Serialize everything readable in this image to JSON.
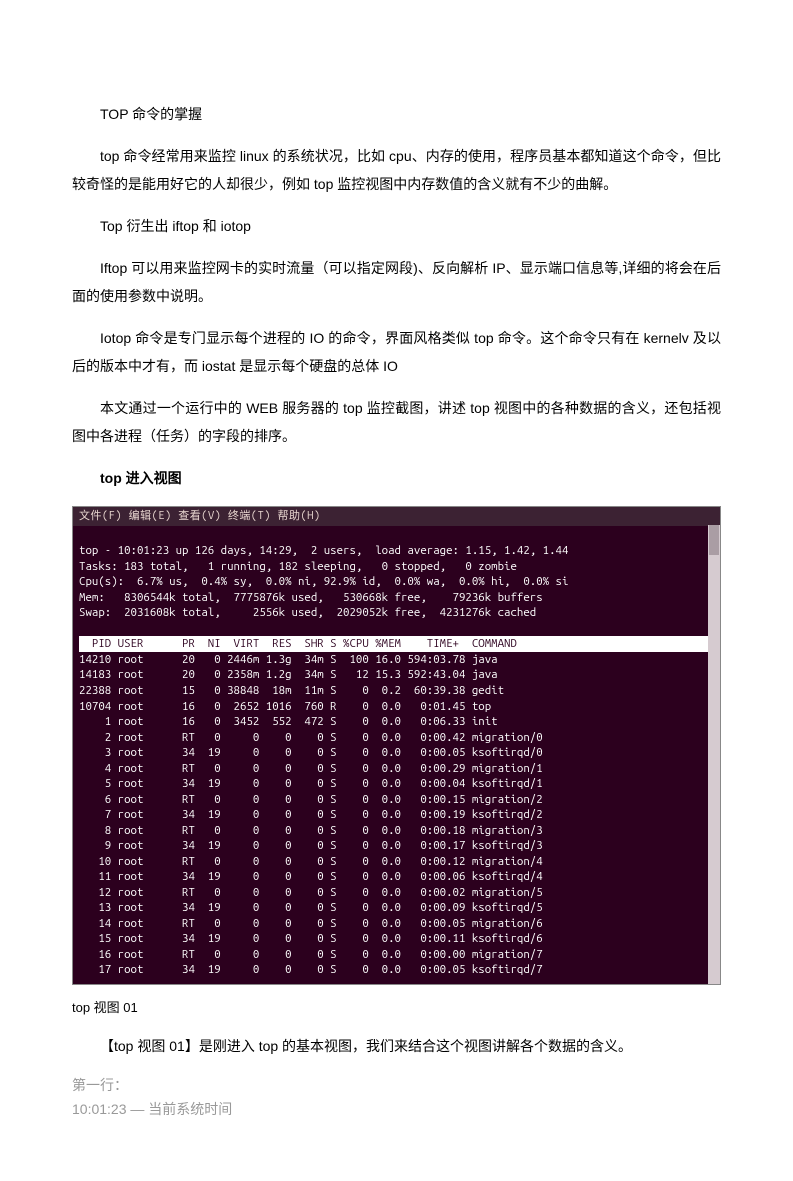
{
  "title": "TOP 命令的掌握",
  "para1": "top 命令经常用来监控 linux 的系统状况，比如 cpu、内存的使用，程序员基本都知道这个命令，但比较奇怪的是能用好它的人却很少，例如 top 监控视图中内存数值的含义就有不少的曲解。",
  "para2": "Top 衍生出 iftop  和  iotop",
  "para3": "Iftop 可以用来监控网卡的实时流量（可以指定网段)、反向解析 IP、显示端口信息等,详细的将会在后面的使用参数中说明。",
  "para4": "Iotop 命令是专门显示每个进程的 IO 的命令，界面风格类似 top 命令。这个命令只有在 kernelv 及以后的版本中才有，而 iostat 是显示每个硬盘的总体 IO",
  "para5": "本文通过一个运行中的 WEB 服务器的 top 监控截图，讲述 top 视图中的各种数据的含义，还包括视图中各进程（任务）的字段的排序。",
  "heading1": "top 进入视图",
  "terminal": {
    "menu": "文件(F)  编辑(E)  查看(V)  终端(T)  帮助(H)",
    "line1": "top - 10:01:23 up 126 days, 14:29,  2 users,  load average: 1.15, 1.42, 1.44",
    "line2": "Tasks: 183 total,   1 running, 182 sleeping,   0 stopped,   0 zombie",
    "line3": "Cpu(s):  6.7% us,  0.4% sy,  0.0% ni, 92.9% id,  0.0% wa,  0.0% hi,  0.0% si",
    "line4": "Mem:   8306544k total,  7775876k used,   530668k free,    79236k buffers",
    "line5": "Swap:  2031608k total,     2556k used,  2029052k free,  4231276k cached",
    "header": "  PID USER      PR  NI  VIRT  RES  SHR S %CPU %MEM    TIME+  COMMAND           ",
    "rows": [
      "14210 root      20   0 2446m 1.3g  34m S  100 16.0 594:03.78 java",
      "14183 root      20   0 2358m 1.2g  34m S   12 15.3 592:43.04 java",
      "22388 root      15   0 38848  18m  11m S    0  0.2  60:39.38 gedit",
      "10704 root      16   0  2652 1016  760 R    0  0.0   0:01.45 top",
      "    1 root      16   0  3452  552  472 S    0  0.0   0:06.33 init",
      "    2 root      RT   0     0    0    0 S    0  0.0   0:00.42 migration/0",
      "    3 root      34  19     0    0    0 S    0  0.0   0:00.05 ksoftirqd/0",
      "    4 root      RT   0     0    0    0 S    0  0.0   0:00.29 migration/1",
      "    5 root      34  19     0    0    0 S    0  0.0   0:00.04 ksoftirqd/1",
      "    6 root      RT   0     0    0    0 S    0  0.0   0:00.15 migration/2",
      "    7 root      34  19     0    0    0 S    0  0.0   0:00.19 ksoftirqd/2",
      "    8 root      RT   0     0    0    0 S    0  0.0   0:00.18 migration/3",
      "    9 root      34  19     0    0    0 S    0  0.0   0:00.17 ksoftirqd/3",
      "   10 root      RT   0     0    0    0 S    0  0.0   0:00.12 migration/4",
      "   11 root      34  19     0    0    0 S    0  0.0   0:00.06 ksoftirqd/4",
      "   12 root      RT   0     0    0    0 S    0  0.0   0:00.02 migration/5",
      "   13 root      34  19     0    0    0 S    0  0.0   0:00.09 ksoftirqd/5",
      "   14 root      RT   0     0    0    0 S    0  0.0   0:00.05 migration/6",
      "   15 root      34  19     0    0    0 S    0  0.0   0:00.11 ksoftirqd/6",
      "   16 root      RT   0     0    0    0 S    0  0.0   0:00.00 migration/7",
      "   17 root      34  19     0    0    0 S    0  0.0   0:00.05 ksoftirqd/7"
    ]
  },
  "caption1": "top 视图  01",
  "para6": "【top 视图  01】是刚进入 top 的基本视图，我们来结合这个视图讲解各个数据的含义。",
  "gray1": "第一行：",
  "gray2": "10:01:23 —  当前系统时间"
}
